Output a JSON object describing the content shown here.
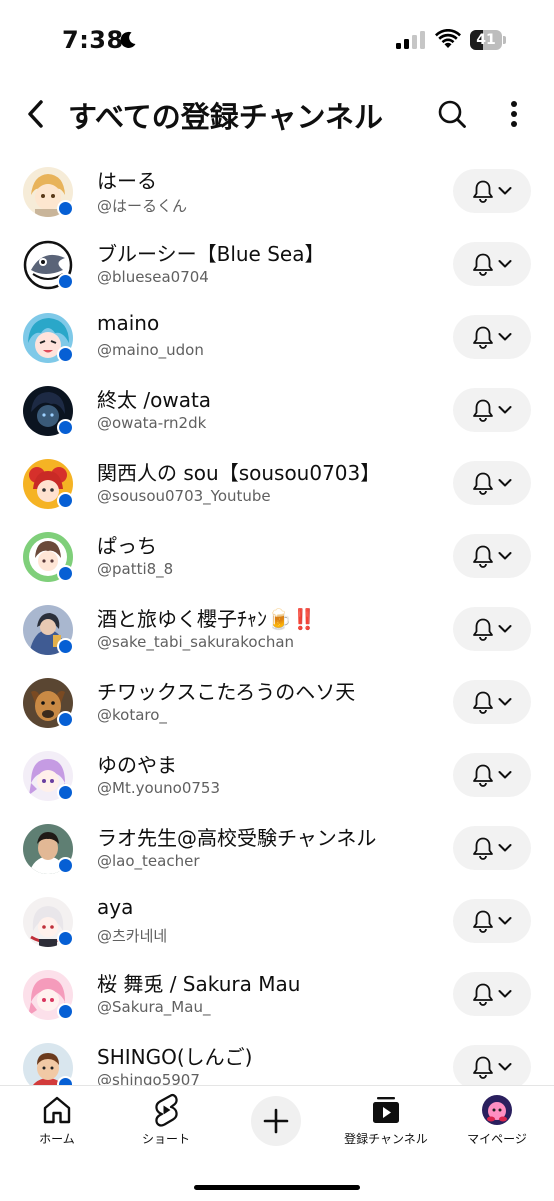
{
  "status_bar": {
    "time": "7:38",
    "battery": "41",
    "battery_level": 0.41
  },
  "header": {
    "title": "すべての登録チャンネル"
  },
  "channels": [
    {
      "name": "はーる",
      "handle": "@はーるくん"
    },
    {
      "name": "ブルーシー【Blue  Sea】",
      "handle": "@bluesea0704"
    },
    {
      "name": "maino",
      "handle": "@maino_udon"
    },
    {
      "name": "終太 /owata",
      "handle": "@owata-rn2dk"
    },
    {
      "name": "関西人の sou【sousou0703】",
      "handle": "@sousou0703_Youtube"
    },
    {
      "name": "ぱっち",
      "handle": "@patti8_8"
    },
    {
      "name": "酒と旅ゆく櫻子ﾁｬﾝ🍺‼️",
      "handle": "@sake_tabi_sakurakochan"
    },
    {
      "name": "チワックスこたろうのヘソ天",
      "handle": "@kotaro_"
    },
    {
      "name": "ゆのやま",
      "handle": "@Mt.youno0753"
    },
    {
      "name": "ラオ先生@高校受験チャンネル",
      "handle": "@lao_teacher"
    },
    {
      "name": "aya",
      "handle": "@츠카네네"
    },
    {
      "name": "桜 舞兎 / Sakura Mau",
      "handle": "@Sakura_Mau_"
    },
    {
      "name": "SHINGO(しんご)",
      "handle": "@shingo5907"
    }
  ],
  "bottom_nav": {
    "home": "ホーム",
    "shorts": "ショート",
    "subscriptions": "登録チャンネル",
    "mypage": "マイページ"
  },
  "colors": {
    "new_dot": "#065fd4",
    "chip_bg": "#f2f2f2",
    "shorts_red": "#ff0000"
  }
}
